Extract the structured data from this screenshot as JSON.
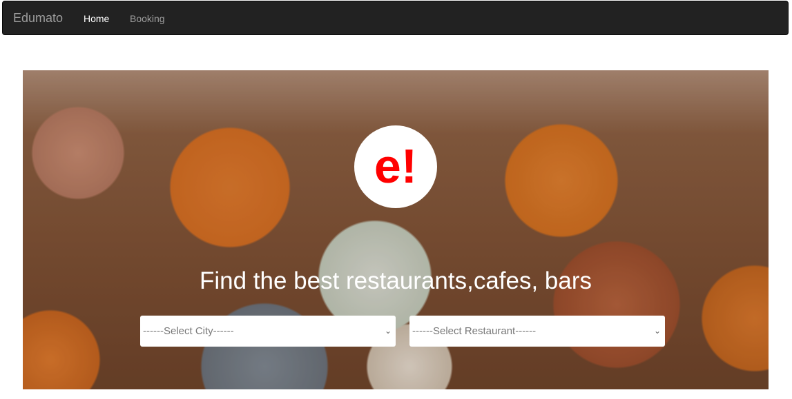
{
  "navbar": {
    "brand": "Edumato",
    "links": [
      {
        "label": "Home",
        "active": true
      },
      {
        "label": "Booking",
        "active": false
      }
    ]
  },
  "hero": {
    "logo_text": "e!",
    "logo_color": "#ff0000",
    "tagline": "Find the best restaurants,cafes, bars",
    "city_select": {
      "selected": "------Select City------"
    },
    "restaurant_select": {
      "selected": "------Select Restaurant------"
    },
    "chevron": "⌄"
  }
}
